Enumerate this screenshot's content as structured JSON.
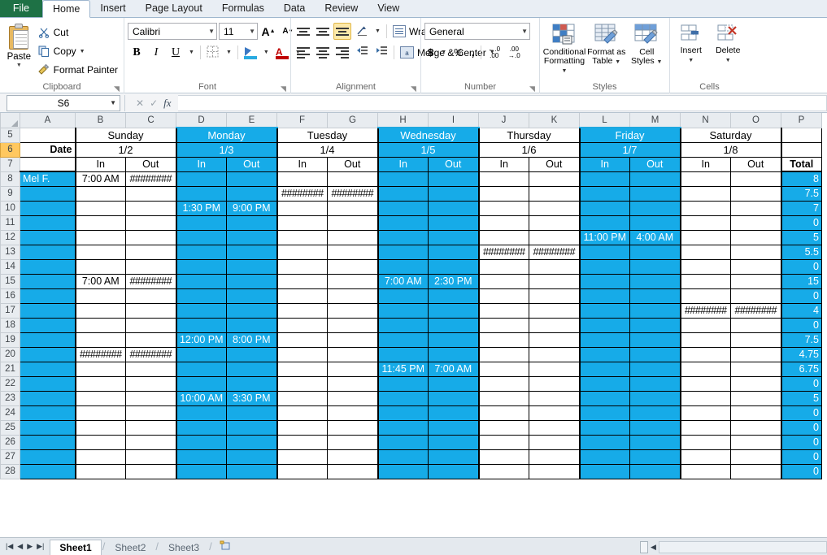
{
  "window": {
    "ribbon_tabs": [
      "File",
      "Home",
      "Insert",
      "Page Layout",
      "Formulas",
      "Data",
      "Review",
      "View"
    ],
    "active_tab": "Home"
  },
  "ribbon": {
    "clipboard": {
      "label": "Clipboard",
      "paste": "Paste",
      "cut": "Cut",
      "copy": "Copy",
      "format_painter": "Format Painter"
    },
    "font": {
      "label": "Font",
      "font_name": "Calibri",
      "font_size": "11",
      "bold": "B",
      "italic": "I",
      "underline": "U"
    },
    "alignment": {
      "label": "Alignment",
      "wrap_text": "Wrap Text",
      "merge_center": "Merge & Center"
    },
    "number": {
      "label": "Number",
      "format": "General",
      "currency": "$",
      "percent": "%",
      "comma": ","
    },
    "styles": {
      "label": "Styles",
      "conditional_formatting": "Conditional Formatting",
      "format_as_table": "Format as Table",
      "cell_styles": "Cell Styles"
    },
    "cells": {
      "label": "Cells",
      "insert": "Insert",
      "delete": "Delete"
    }
  },
  "formula_bar": {
    "name_box": "S6",
    "formula": ""
  },
  "grid": {
    "columns": [
      "A",
      "B",
      "C",
      "D",
      "E",
      "F",
      "G",
      "H",
      "I",
      "J",
      "K",
      "L",
      "M",
      "N",
      "O",
      "P"
    ],
    "selected_columns": [
      "D",
      "E",
      "H",
      "I",
      "L",
      "M"
    ],
    "selected_row": "6",
    "row_numbers": [
      "5",
      "6",
      "7",
      "8",
      "9",
      "10",
      "11",
      "12",
      "13",
      "14",
      "15",
      "16",
      "17",
      "18",
      "19",
      "20",
      "21",
      "22",
      "23",
      "24",
      "25",
      "26",
      "27",
      "28"
    ],
    "accent_color": "#16ABE8",
    "header_rows": {
      "days": [
        "",
        "Sunday",
        "Monday",
        "Tuesday",
        "Wednesday",
        "Thursday",
        "Friday",
        "Saturday",
        ""
      ],
      "date_label": "Date",
      "dates": [
        "1/2",
        "1/3",
        "1/4",
        "1/5",
        "1/6",
        "1/7",
        "1/8"
      ],
      "in_label": "In",
      "out_label": "Out",
      "total_label": "Total"
    },
    "employee_name": "Mel F.",
    "hash_text": "########",
    "rows": [
      {
        "n": "8",
        "cells": [
          "7:00 AM",
          "########",
          "",
          "",
          "",
          "",
          "",
          "",
          "",
          "",
          "",
          "",
          "",
          ""
        ],
        "total": "8"
      },
      {
        "n": "9",
        "cells": [
          "",
          "",
          "",
          "",
          "########",
          "########",
          "",
          "",
          "",
          "",
          "",
          "",
          "",
          ""
        ],
        "total": "7.5"
      },
      {
        "n": "10",
        "cells": [
          "",
          "",
          "1:30 PM",
          "9:00 PM",
          "",
          "",
          "",
          "",
          "",
          "",
          "",
          "",
          "",
          ""
        ],
        "total": "7"
      },
      {
        "n": "11",
        "cells": [
          "",
          "",
          "",
          "",
          "",
          "",
          "",
          "",
          "",
          "",
          "",
          "",
          "",
          ""
        ],
        "total": "0"
      },
      {
        "n": "12",
        "cells": [
          "",
          "",
          "",
          "",
          "",
          "",
          "",
          "",
          "",
          "",
          "11:00 PM",
          "4:00 AM",
          "",
          ""
        ],
        "total": "5"
      },
      {
        "n": "13",
        "cells": [
          "",
          "",
          "",
          "",
          "",
          "",
          "",
          "",
          "########",
          "########",
          "",
          "",
          "",
          ""
        ],
        "total": "5.5"
      },
      {
        "n": "14",
        "cells": [
          "",
          "",
          "",
          "",
          "",
          "",
          "",
          "",
          "",
          "",
          "",
          "",
          "",
          ""
        ],
        "total": "0"
      },
      {
        "n": "15",
        "cells": [
          "7:00 AM",
          "########",
          "",
          "",
          "",
          "",
          "7:00 AM",
          "2:30 PM",
          "",
          "",
          "",
          "",
          "",
          ""
        ],
        "total": "15"
      },
      {
        "n": "16",
        "cells": [
          "",
          "",
          "",
          "",
          "",
          "",
          "",
          "",
          "",
          "",
          "",
          "",
          "",
          ""
        ],
        "total": "0"
      },
      {
        "n": "17",
        "cells": [
          "",
          "",
          "",
          "",
          "",
          "",
          "",
          "",
          "",
          "",
          "",
          "",
          "########",
          "########"
        ],
        "total": "4"
      },
      {
        "n": "18",
        "cells": [
          "",
          "",
          "",
          "",
          "",
          "",
          "",
          "",
          "",
          "",
          "",
          "",
          "",
          ""
        ],
        "total": "0"
      },
      {
        "n": "19",
        "cells": [
          "",
          "",
          "12:00 PM",
          "8:00 PM",
          "",
          "",
          "",
          "",
          "",
          "",
          "",
          "",
          "",
          ""
        ],
        "total": "7.5"
      },
      {
        "n": "20",
        "cells": [
          "########",
          "########",
          "",
          "",
          "",
          "",
          "",
          "",
          "",
          "",
          "",
          "",
          "",
          ""
        ],
        "total": "4.75"
      },
      {
        "n": "21",
        "cells": [
          "",
          "",
          "",
          "",
          "",
          "",
          "11:45 PM",
          "7:00 AM",
          "",
          "",
          "",
          "",
          "",
          ""
        ],
        "total": "6.75"
      },
      {
        "n": "22",
        "cells": [
          "",
          "",
          "",
          "",
          "",
          "",
          "",
          "",
          "",
          "",
          "",
          "",
          "",
          ""
        ],
        "total": "0"
      },
      {
        "n": "23",
        "cells": [
          "",
          "",
          "10:00 AM",
          "3:30 PM",
          "",
          "",
          "",
          "",
          "",
          "",
          "",
          "",
          "",
          ""
        ],
        "total": "5"
      },
      {
        "n": "24",
        "cells": [
          "",
          "",
          "",
          "",
          "",
          "",
          "",
          "",
          "",
          "",
          "",
          "",
          "",
          ""
        ],
        "total": "0"
      },
      {
        "n": "25",
        "cells": [
          "",
          "",
          "",
          "",
          "",
          "",
          "",
          "",
          "",
          "",
          "",
          "",
          "",
          ""
        ],
        "total": "0"
      },
      {
        "n": "26",
        "cells": [
          "",
          "",
          "",
          "",
          "",
          "",
          "",
          "",
          "",
          "",
          "",
          "",
          "",
          ""
        ],
        "total": "0"
      },
      {
        "n": "27",
        "cells": [
          "",
          "",
          "",
          "",
          "",
          "",
          "",
          "",
          "",
          "",
          "",
          "",
          "",
          ""
        ],
        "total": "0"
      },
      {
        "n": "28",
        "cells": [
          "",
          "",
          "",
          "",
          "",
          "",
          "",
          "",
          "",
          "",
          "",
          "",
          "",
          ""
        ],
        "total": "0"
      }
    ]
  },
  "sheet_tabs": {
    "tabs": [
      "Sheet1",
      "Sheet2",
      "Sheet3"
    ],
    "active": "Sheet1",
    "new_sheet_icon": "insert-worksheet-icon"
  },
  "icons": {
    "cut": "scissors-icon",
    "copy": "copy-icon",
    "format_painter": "paintbrush-icon",
    "paste": "clipboard-icon",
    "fx": "fx-icon"
  }
}
